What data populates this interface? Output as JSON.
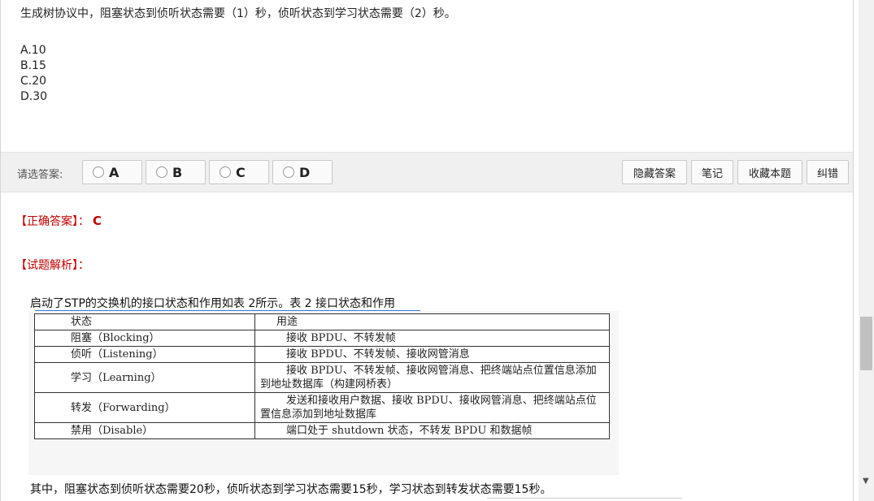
{
  "question": {
    "text": "生成树协议中，阻塞状态到侦听状态需要（1）秒，侦听状态到学习状态需要（2）秒。",
    "options": [
      "A.10",
      "B.15",
      "C.20",
      "D.30"
    ]
  },
  "answer_bar": {
    "label": "请选答案:",
    "choices": [
      "A",
      "B",
      "C",
      "D"
    ],
    "buttons": [
      "隐藏答案",
      "笔记",
      "收藏本题",
      "纠错"
    ]
  },
  "solution": {
    "correct_label": "【正确答案】：",
    "correct_answer": "C",
    "analysis_label": "【试题解析】：",
    "intro": "启动了STP的交换机的接口状态和作用如表 2所示。表 2 接口状态和作用",
    "table": {
      "headers": [
        "状态",
        "用途"
      ],
      "rows": [
        [
          "阻塞（Blocking）",
          "接收 BPDU、不转发帧"
        ],
        [
          "侦听（Listening）",
          "接收 BPDU、不转发帧、接收网管消息"
        ],
        [
          "学习（Learning）",
          "接收 BPDU、不转发帧、接收网管消息、把终端站点位置信息添加到地址数据库（构建网桥表）"
        ],
        [
          "转发（Forwarding）",
          "发送和接收用户数据、接收 BPDU、接收网管消息、把终端站点位置信息添加到地址数据库"
        ],
        [
          "禁用（Disable）",
          "端口处于 shutdown 状态，不转发 BPDU 和数据帧"
        ]
      ]
    },
    "conclusion": "其中，阻塞状态到侦听状态需要20秒，侦听状态到学习状态需要15秒，学习状态到转发状态需要15秒。"
  },
  "icons": {
    "scroll_down": "chevron-down-icon",
    "radio": "radio-circle-icon"
  }
}
